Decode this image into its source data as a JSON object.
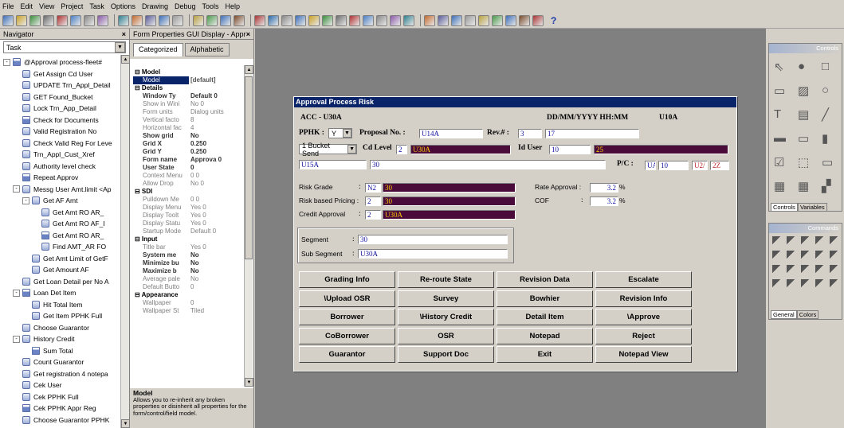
{
  "menu": [
    "File",
    "Edit",
    "View",
    "Project",
    "Task",
    "Options",
    "Drawing",
    "Debug",
    "Tools",
    "Help"
  ],
  "toolbar_help": "?",
  "navigator": {
    "title": "Navigator",
    "close": "×",
    "combo_value": "Task",
    "items": [
      {
        "label": "@Approval process-fleet#",
        "level": 0,
        "expander": "-"
      },
      {
        "label": "Get Assign Cd User",
        "level": 1
      },
      {
        "label": "UPDATE Trn_Appl_Detail",
        "level": 1
      },
      {
        "label": "GET Found_Bucket",
        "level": 1
      },
      {
        "label": "Lock Trn_App_Detail",
        "level": 1
      },
      {
        "label": "Check for Documents",
        "level": 1
      },
      {
        "label": "Valid Registration No",
        "level": 1
      },
      {
        "label": "Check Valid Reg For Leve",
        "level": 1
      },
      {
        "label": "Trn_Appl_Cust_Xref",
        "level": 1
      },
      {
        "label": "Authority level check",
        "level": 1
      },
      {
        "label": "Repeat Approv",
        "level": 1
      },
      {
        "label": "Messg User Amt.limit <Ap",
        "level": 1,
        "expander": "-"
      },
      {
        "label": "Get AF Amt",
        "level": 2,
        "expander": "-"
      },
      {
        "label": "Get Amt RO AR_",
        "level": 3
      },
      {
        "label": "Get Amt RO AF_I",
        "level": 3
      },
      {
        "label": "Get Amt RO AR_",
        "level": 3
      },
      {
        "label": "Find AMT_AR FO",
        "level": 3
      },
      {
        "label": "Get Amt Limit of GetF",
        "level": 2
      },
      {
        "label": "Get Amount AF",
        "level": 2
      },
      {
        "label": "Get Loan Detail per No A",
        "level": 1
      },
      {
        "label": "Loan Det Item",
        "level": 1,
        "expander": "-"
      },
      {
        "label": "Hit Total Item",
        "level": 2
      },
      {
        "label": "Get Item PPHK Full",
        "level": 2
      },
      {
        "label": "Choose Guarantor",
        "level": 1
      },
      {
        "label": "History Credit",
        "level": 1,
        "expander": "-"
      },
      {
        "label": "Sum Total",
        "level": 2
      },
      {
        "label": "Count Guarantor",
        "level": 1
      },
      {
        "label": "Get registration 4 notepa",
        "level": 1
      },
      {
        "label": "Cek User",
        "level": 1
      },
      {
        "label": "Cek PPHK Full",
        "level": 1
      },
      {
        "label": "Cek PPHK Appr Reg",
        "level": 1
      },
      {
        "label": "Choose Guarantor PPHK",
        "level": 1
      }
    ]
  },
  "props": {
    "title": "Form Properties GUI Display - Approv",
    "close": "×",
    "tab_categorized": "Categorized",
    "tab_alphabetic": "Alphabetic",
    "rows": [
      {
        "t": "cat",
        "k": "⊟ Model"
      },
      {
        "t": "sel",
        "k": "Model",
        "v": "[default]"
      },
      {
        "t": "cat",
        "k": "⊟ Details"
      },
      {
        "t": "b",
        "k": "Window Ty",
        "v": "Default  0"
      },
      {
        "t": "g",
        "k": "Show in Wini",
        "v": "No        0"
      },
      {
        "t": "g",
        "k": "Form units",
        "v": "Dialog units"
      },
      {
        "t": "g",
        "k": "Vertical facto",
        "v": "8"
      },
      {
        "t": "g",
        "k": "Horizontal fac",
        "v": "4"
      },
      {
        "t": "b",
        "k": "Show grid",
        "v": "No"
      },
      {
        "t": "b",
        "k": "Grid X",
        "v": "0.250"
      },
      {
        "t": "b",
        "k": "Grid Y",
        "v": "0.250"
      },
      {
        "t": "b",
        "k": "Form name",
        "v": "Approva 0"
      },
      {
        "t": "b",
        "k": "User State",
        "v": "0"
      },
      {
        "t": "g",
        "k": "Context Menu",
        "v": "0         0"
      },
      {
        "t": "g",
        "k": "Allow Drop",
        "v": "No        0"
      },
      {
        "t": "cat",
        "k": "⊟ SDI"
      },
      {
        "t": "g",
        "k": "Pulldown Me",
        "v": "0         0"
      },
      {
        "t": "g",
        "k": "Display Menu",
        "v": "Yes       0"
      },
      {
        "t": "g",
        "k": "Display Toolt",
        "v": "Yes       0"
      },
      {
        "t": "g",
        "k": "Display Statu",
        "v": "Yes       0"
      },
      {
        "t": "g",
        "k": "Startup Mode",
        "v": "Default   0"
      },
      {
        "t": "cat",
        "k": "⊟ Input"
      },
      {
        "t": "g",
        "k": "Title bar",
        "v": "Yes       0"
      },
      {
        "t": "b",
        "k": "System me",
        "v": "No"
      },
      {
        "t": "b",
        "k": "Minimize bu",
        "v": "No"
      },
      {
        "t": "b",
        "k": "Maximize b",
        "v": "No"
      },
      {
        "t": "g",
        "k": "Average pale",
        "v": "No"
      },
      {
        "t": "g",
        "k": "Default Butto",
        "v": "          0"
      },
      {
        "t": "cat",
        "k": "⊟ Appearance"
      },
      {
        "t": "g",
        "k": "Wallpaper",
        "v": "          0"
      },
      {
        "t": "g",
        "k": "Wallpaper St",
        "v": "Tiled"
      }
    ],
    "desc_title": "Model",
    "desc_text": "Allows you to re-inherit any broken properties or disinherit all properties for the form/control/field model."
  },
  "form": {
    "title": "Approval Process Risk",
    "acc": "ACC - U30A",
    "datetime": "DD/MM/YYYY   HH:MM",
    "user_code": "U10A",
    "pphk_label": "PPHK :",
    "pphk_value": "Y",
    "proposal_label": "Proposal No.  :",
    "proposal_value": "U14A",
    "rev_label": "Rev.# :",
    "rev_value": "3",
    "rev_value2": "17",
    "bucket_value": "1 Bucket Send",
    "cd_level_label": "Cd Level",
    "cd_level_value": "2",
    "cd_level_text": "U30A",
    "id_user_label": "Id User",
    "id_user_value": "10",
    "id_user_value2": "25",
    "row3_a": "U15A",
    "row3_b": "30",
    "pc_label": "P/C :",
    "pc_a": "UA",
    "pc_b": "10",
    "pc_c": "U2/",
    "pc_d": "2Z",
    "risk_grade_label": "Risk Grade",
    "risk_grade_a": "N2",
    "risk_grade_b": "30",
    "risk_pricing_label": "Risk based Pricing :",
    "risk_pricing_a": "2",
    "risk_pricing_b": "30",
    "credit_approval_label": "Credit Approval",
    "credit_approval_a": "2",
    "credit_approval_b": "U30A",
    "rate_approval_label": "Rate Approval  :",
    "rate_approval_value": "3.2",
    "cof_label": "COF",
    "cof_value": "3.2",
    "pct": "%",
    "segment_label": "Segment",
    "segment_value": "30",
    "subsegment_label": "Sub Segment",
    "subsegment_value": "U30A",
    "colon": ":",
    "buttons": [
      [
        "Grading Info",
        "Re-route State",
        "Revision Data",
        "Escalate"
      ],
      [
        "\\Upload OSR",
        "Survey",
        "Bowhier",
        "Revision Info"
      ],
      [
        "Borrower",
        "\\History Credit",
        "Detail Item",
        "\\Approve"
      ],
      [
        "CoBorrower",
        "OSR",
        "Notepad",
        "Reject"
      ],
      [
        "Guarantor",
        "Support Doc",
        "Exit",
        "Notepad View"
      ]
    ]
  },
  "controls": {
    "title": "Controls",
    "tab_controls": "Controls",
    "tab_variables": "Variables",
    "commands_title": "Commands",
    "tab_general": "General",
    "tab_colors": "Colors"
  }
}
